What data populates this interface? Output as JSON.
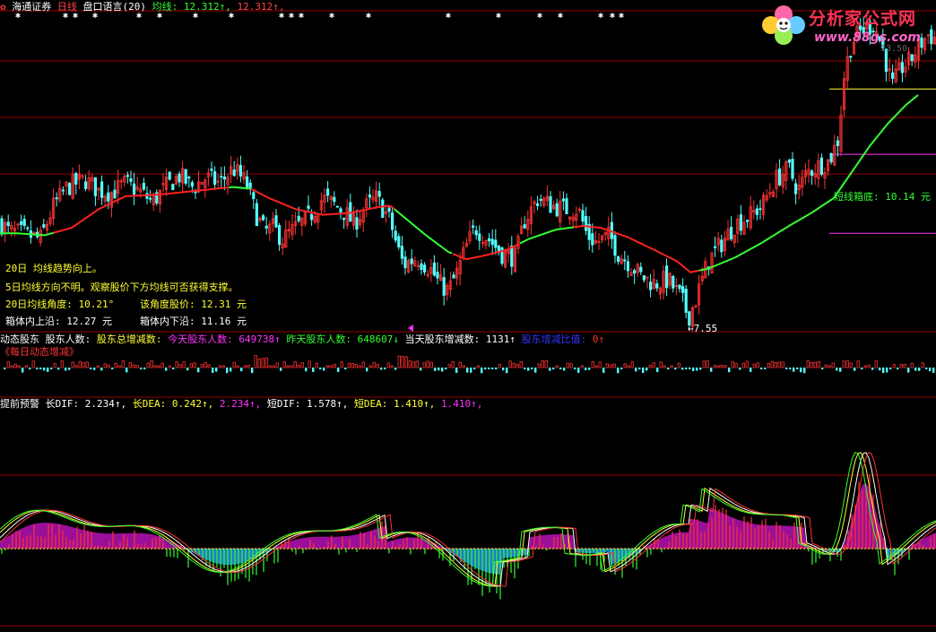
{
  "header": {
    "broker": "海通证券",
    "period": "日线",
    "indicator_name": "盘口语言(20)",
    "ma_label": "均线:",
    "ma_value": "12.312↑,",
    "ma_value2": "12.312↑,"
  },
  "watermark": {
    "title": "分析家公式网",
    "url": "www.88gs.com",
    "hidden_label": "13.50"
  },
  "annotations": {
    "low_price": "←7.55",
    "box_bottom": "短线箱底: 10.14 元",
    "trend_line1": "20日 均线趋势向上。",
    "trend_line2": "5日均线方向不明。观察股价下方均线可否获得支撑。",
    "angle_label": "20日均线角度: 10.21°",
    "angle_price_label": "该角度股价: 12.31 元",
    "box_top_label": "箱体内上沿: 12.27 元",
    "box_bottom_label": "箱体内下沿: 11.16 元"
  },
  "panel2": {
    "name": "动态股东",
    "holders_label": "股东人数:",
    "total_change_label": "股东总增减数:",
    "today_label": "今天股东人数:",
    "today_value": "649738↑",
    "yesterday_label": "昨天股东人数:",
    "yesterday_value": "648607↓",
    "day_change_label": "当天股东增减数:",
    "day_change_value": "1131↑",
    "ratio_label": "股东增减比值:",
    "ratio_value": "0↑",
    "subtitle": "《每日动态增减》"
  },
  "panel3": {
    "name": "提前预警",
    "long_dif_label": "长DIF:",
    "long_dif_value": "2.234↑,",
    "long_dea_label": "长DEA:",
    "long_dea_value": "0.242↑,",
    "extra_value": "2.234↑,",
    "short_dif_label": "短DIF:",
    "short_dif_value": "1.578↑,",
    "short_dea_label": "短DEA:",
    "short_dea_value": "1.410↑,",
    "extra_value2": "1.410↑,"
  },
  "colors": {
    "background": "#000000",
    "up_candle": "#ff3333",
    "down_candle": "#55ffff",
    "ma_up": "#ff2222",
    "ma_down": "#33ff33",
    "gridline": "#990000",
    "box_top_line": "#ffff33",
    "box_mid_line": "#ff33ff",
    "box_bottom_line": "#ff33ff",
    "macd_fill_pos": "#aa11aa",
    "macd_fill_neg": "#2288dd",
    "green_bar": "#33ff33",
    "red_bar": "#ff3333"
  },
  "chart_data": {
    "type": "candlestick",
    "price_path": [
      [
        0,
        10.15
      ],
      [
        10,
        9.9
      ],
      [
        25,
        9.85
      ],
      [
        45,
        9.7
      ],
      [
        60,
        10.6
      ],
      [
        75,
        11.1
      ],
      [
        95,
        11.3
      ],
      [
        110,
        11.0
      ],
      [
        125,
        10.95
      ],
      [
        140,
        11.2
      ],
      [
        155,
        11.0
      ],
      [
        170,
        10.7
      ],
      [
        185,
        11.1
      ],
      [
        200,
        11.4
      ],
      [
        215,
        11.1
      ],
      [
        230,
        11.35
      ],
      [
        245,
        11.2
      ],
      [
        260,
        11.6
      ],
      [
        275,
        11.2
      ],
      [
        285,
        10.4
      ],
      [
        295,
        9.9
      ],
      [
        305,
        10.0
      ],
      [
        315,
        9.7
      ],
      [
        330,
        10.0
      ],
      [
        345,
        10.3
      ],
      [
        360,
        10.8
      ],
      [
        375,
        10.6
      ],
      [
        385,
        10.4
      ],
      [
        395,
        10.1
      ],
      [
        405,
        10.5
      ],
      [
        420,
        10.8
      ],
      [
        435,
        10.2
      ],
      [
        443,
        9.5
      ],
      [
        450,
        9.0
      ],
      [
        465,
        9.2
      ],
      [
        480,
        8.9
      ],
      [
        490,
        8.5
      ],
      [
        500,
        8.3
      ],
      [
        510,
        8.8
      ],
      [
        520,
        9.5
      ],
      [
        530,
        10.0
      ],
      [
        545,
        9.7
      ],
      [
        560,
        9.3
      ],
      [
        575,
        9.2
      ],
      [
        585,
        10.2
      ],
      [
        600,
        10.8
      ],
      [
        615,
        10.6
      ],
      [
        630,
        10.5
      ],
      [
        645,
        10.5
      ],
      [
        655,
        9.8
      ],
      [
        665,
        9.6
      ],
      [
        680,
        9.8
      ],
      [
        690,
        9.3
      ],
      [
        700,
        9.1
      ],
      [
        715,
        8.7
      ],
      [
        730,
        8.5
      ],
      [
        745,
        8.6
      ],
      [
        760,
        8.1
      ],
      [
        768,
        7.6
      ],
      [
        775,
        8.0
      ],
      [
        790,
        9.1
      ],
      [
        805,
        9.6
      ],
      [
        820,
        10.1
      ],
      [
        835,
        10.3
      ],
      [
        850,
        10.6
      ],
      [
        865,
        11.3
      ],
      [
        880,
        11.6
      ],
      [
        890,
        11.0
      ],
      [
        900,
        11.5
      ],
      [
        915,
        11.7
      ],
      [
        925,
        11.8
      ],
      [
        935,
        12.4
      ],
      [
        942,
        14.2
      ],
      [
        950,
        15.0
      ],
      [
        960,
        15.3
      ],
      [
        975,
        15.5
      ],
      [
        985,
        14.8
      ],
      [
        995,
        13.8
      ],
      [
        1005,
        14.3
      ],
      [
        1015,
        14.5
      ],
      [
        1025,
        14.9
      ],
      [
        1035,
        15.2
      ],
      [
        1044,
        15.1
      ]
    ],
    "ma20_path": [
      [
        0,
        9.85
      ],
      [
        20,
        9.85
      ],
      [
        50,
        9.8
      ],
      [
        80,
        10.0
      ],
      [
        110,
        10.5
      ],
      [
        140,
        10.85
      ],
      [
        180,
        10.9
      ],
      [
        220,
        11.0
      ],
      [
        260,
        11.1
      ],
      [
        280,
        11.05
      ],
      [
        300,
        10.8
      ],
      [
        330,
        10.5
      ],
      [
        360,
        10.35
      ],
      [
        390,
        10.4
      ],
      [
        420,
        10.55
      ],
      [
        435,
        10.6
      ],
      [
        450,
        10.3
      ],
      [
        475,
        9.8
      ],
      [
        500,
        9.35
      ],
      [
        520,
        9.15
      ],
      [
        540,
        9.25
      ],
      [
        565,
        9.4
      ],
      [
        590,
        9.7
      ],
      [
        620,
        9.95
      ],
      [
        650,
        10.05
      ],
      [
        670,
        10.0
      ],
      [
        700,
        9.75
      ],
      [
        730,
        9.4
      ],
      [
        755,
        9.1
      ],
      [
        770,
        8.8
      ],
      [
        790,
        8.9
      ],
      [
        820,
        9.2
      ],
      [
        850,
        9.6
      ],
      [
        880,
        10.05
      ],
      [
        905,
        10.4
      ],
      [
        930,
        10.8
      ],
      [
        950,
        11.5
      ],
      [
        970,
        12.2
      ],
      [
        990,
        12.8
      ],
      [
        1010,
        13.3
      ],
      [
        1025,
        13.6
      ]
    ],
    "ma20_turn_up_x": [
      0,
      60,
      255,
      280,
      440,
      505,
      580,
      640,
      780
    ],
    "low_point": 7.55,
    "box_top": 13.5,
    "box_upper": 12.27,
    "box_lower": 11.16,
    "box_bottom": 10.14,
    "price_range": [
      7.2,
      15.8
    ],
    "macd": {
      "long_dif": 2.234,
      "long_dea": 0.242,
      "short_dif": 1.578,
      "short_dea": 1.41
    },
    "holders": {
      "today": 649738,
      "yesterday": 648607,
      "day_change": 1131,
      "ratio": 0
    }
  }
}
